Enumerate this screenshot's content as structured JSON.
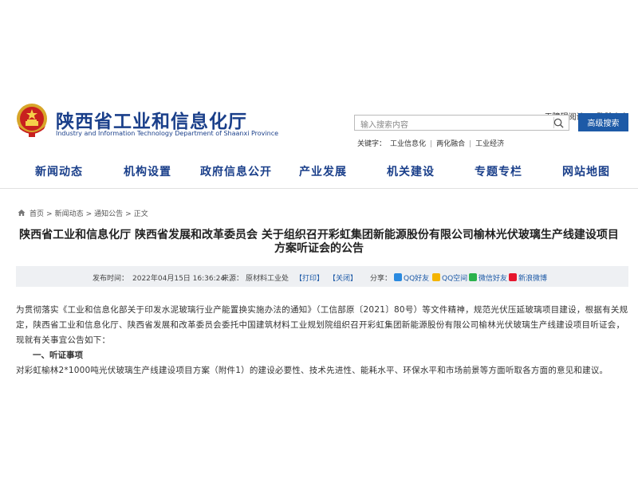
{
  "header": {
    "accessible_reading": "无障碍阅读",
    "language_toggle": "繁體中文",
    "site_title": "陕西省工业和信息化厅",
    "site_subtitle": "Industry and Information Technology Department of Shaanxi Province",
    "search_placeholder": "输入搜索内容",
    "advanced_search": "高级搜索",
    "keywords_label": "关键字：",
    "keywords": [
      "工业信息化",
      "两化融合",
      "工业经济"
    ]
  },
  "nav": {
    "items": [
      "新闻动态",
      "机构设置",
      "政府信息公开",
      "产业发展",
      "机关建设",
      "专题专栏",
      "网站地图"
    ]
  },
  "breadcrumb": [
    "首页",
    "新闻动态",
    "通知公告",
    "正文"
  ],
  "article": {
    "title_line1": "陕西省工业和信息化厅 陕西省发展和改革委员会 关于组织召开彩虹集团新能源股份有限公司榆林光伏玻璃生产线建设项目",
    "title_line2": "方案听证会的公告",
    "published_label": "发布时间：",
    "published_time": "2022年04月15日 16:36:24",
    "source_label": "来源：",
    "source": "原材料工业处",
    "print": "【打印】",
    "close": "【关闭】",
    "share_label": "分享：",
    "share": [
      "QQ好友",
      "QQ空间",
      "微信好友",
      "新浪微博"
    ],
    "colors": {
      "qq": "#2a8ae0",
      "qzone": "#f4b400",
      "wechat": "#2bb24c",
      "weibo": "#e6162d"
    },
    "paragraph1": "为贯彻落实《工业和信息化部关于印发水泥玻璃行业产能置换实施办法的通知》（工信部原〔2021〕80号）等文件精神，规范光伏压延玻璃项目建设，根据有关规定，陕西省工业和信息化厅、陕西省发展和改革委员会委托中国建筑材料工业规划院组织召开彩虹集团新能源股份有限公司榆林光伏玻璃生产线建设项目听证会，现就有关事宜公告如下：",
    "heading1": "一、听证事项",
    "paragraph2": "对彩虹榆林2*1000吨光伏玻璃生产线建设项目方案（附件1）的建设必要性、技术先进性、能耗水平、环保水平和市场前景等方面听取各方面的意见和建议。"
  }
}
